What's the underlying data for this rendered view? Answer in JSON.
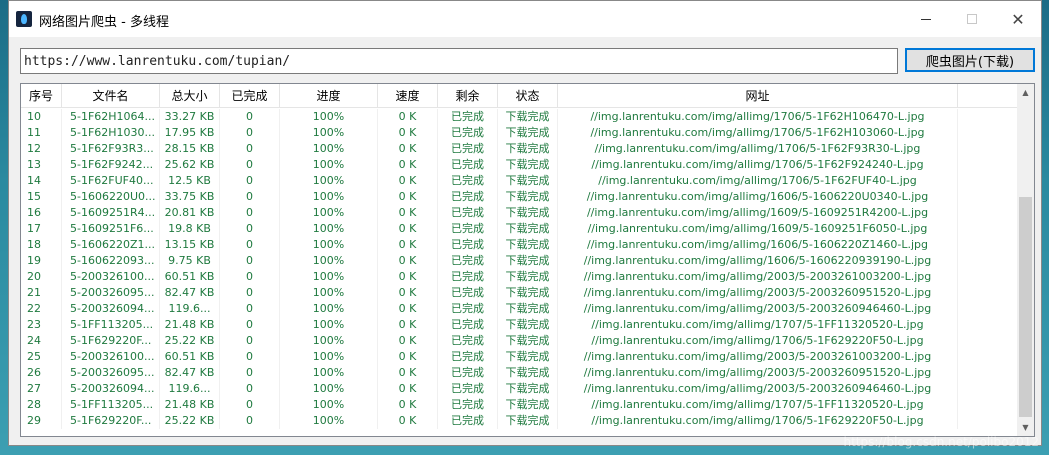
{
  "window": {
    "title": "网络图片爬虫 - 多线程",
    "close_glyph": "✕",
    "app_icon": "app-flame-icon"
  },
  "toolbar": {
    "url_value": "https://www.lanrentuku.com/tupian/",
    "crawl_button_label": "爬虫图片(下载)"
  },
  "table": {
    "columns": [
      "序号",
      "文件名",
      "总大小",
      "已完成",
      "进度",
      "速度",
      "剩余",
      "状态",
      "网址"
    ],
    "rows": [
      [
        "10",
        "5-1F62H1064...",
        "33.27 KB",
        "0",
        "100%",
        "0 K",
        "已完成",
        "下载完成",
        "//img.lanrentuku.com/img/allimg/1706/5-1F62H106470-L.jpg"
      ],
      [
        "11",
        "5-1F62H1030...",
        "17.95 KB",
        "0",
        "100%",
        "0 K",
        "已完成",
        "下载完成",
        "//img.lanrentuku.com/img/allimg/1706/5-1F62H103060-L.jpg"
      ],
      [
        "12",
        "5-1F62F93R3...",
        "28.15 KB",
        "0",
        "100%",
        "0 K",
        "已完成",
        "下载完成",
        "//img.lanrentuku.com/img/allimg/1706/5-1F62F93R30-L.jpg"
      ],
      [
        "13",
        "5-1F62F9242...",
        "25.62 KB",
        "0",
        "100%",
        "0 K",
        "已完成",
        "下载完成",
        "//img.lanrentuku.com/img/allimg/1706/5-1F62F924240-L.jpg"
      ],
      [
        "14",
        "5-1F62FUF40...",
        "12.5 KB",
        "0",
        "100%",
        "0 K",
        "已完成",
        "下载完成",
        "//img.lanrentuku.com/img/allimg/1706/5-1F62FUF40-L.jpg"
      ],
      [
        "15",
        "5-1606220U0...",
        "33.75 KB",
        "0",
        "100%",
        "0 K",
        "已完成",
        "下载完成",
        "//img.lanrentuku.com/img/allimg/1606/5-1606220U0340-L.jpg"
      ],
      [
        "16",
        "5-1609251R4...",
        "20.81 KB",
        "0",
        "100%",
        "0 K",
        "已完成",
        "下载完成",
        "//img.lanrentuku.com/img/allimg/1609/5-1609251R4200-L.jpg"
      ],
      [
        "17",
        "5-1609251F6...",
        "19.8 KB",
        "0",
        "100%",
        "0 K",
        "已完成",
        "下载完成",
        "//img.lanrentuku.com/img/allimg/1609/5-1609251F6050-L.jpg"
      ],
      [
        "18",
        "5-1606220Z1...",
        "13.15 KB",
        "0",
        "100%",
        "0 K",
        "已完成",
        "下载完成",
        "//img.lanrentuku.com/img/allimg/1606/5-1606220Z1460-L.jpg"
      ],
      [
        "19",
        "5-160622093...",
        "9.75 KB",
        "0",
        "100%",
        "0 K",
        "已完成",
        "下载完成",
        "//img.lanrentuku.com/img/allimg/1606/5-1606220939190-L.jpg"
      ],
      [
        "20",
        "5-200326100...",
        "60.51 KB",
        "0",
        "100%",
        "0 K",
        "已完成",
        "下载完成",
        "//img.lanrentuku.com/img/allimg/2003/5-2003261003200-L.jpg"
      ],
      [
        "21",
        "5-200326095...",
        "82.47 KB",
        "0",
        "100%",
        "0 K",
        "已完成",
        "下载完成",
        "//img.lanrentuku.com/img/allimg/2003/5-2003260951520-L.jpg"
      ],
      [
        "22",
        "5-200326094...",
        "119.6...",
        "0",
        "100%",
        "0 K",
        "已完成",
        "下载完成",
        "//img.lanrentuku.com/img/allimg/2003/5-2003260946460-L.jpg"
      ],
      [
        "23",
        "5-1FF113205...",
        "21.48 KB",
        "0",
        "100%",
        "0 K",
        "已完成",
        "下载完成",
        "//img.lanrentuku.com/img/allimg/1707/5-1FF11320520-L.jpg"
      ],
      [
        "24",
        "5-1F629220F...",
        "25.22 KB",
        "0",
        "100%",
        "0 K",
        "已完成",
        "下载完成",
        "//img.lanrentuku.com/img/allimg/1706/5-1F629220F50-L.jpg"
      ],
      [
        "25",
        "5-200326100...",
        "60.51 KB",
        "0",
        "100%",
        "0 K",
        "已完成",
        "下载完成",
        "//img.lanrentuku.com/img/allimg/2003/5-2003261003200-L.jpg"
      ],
      [
        "26",
        "5-200326095...",
        "82.47 KB",
        "0",
        "100%",
        "0 K",
        "已完成",
        "下载完成",
        "//img.lanrentuku.com/img/allimg/2003/5-2003260951520-L.jpg"
      ],
      [
        "27",
        "5-200326094...",
        "119.6...",
        "0",
        "100%",
        "0 K",
        "已完成",
        "下载完成",
        "//img.lanrentuku.com/img/allimg/2003/5-2003260946460-L.jpg"
      ],
      [
        "28",
        "5-1FF113205...",
        "21.48 KB",
        "0",
        "100%",
        "0 K",
        "已完成",
        "下载完成",
        "//img.lanrentuku.com/img/allimg/1707/5-1FF11320520-L.jpg"
      ],
      [
        "29",
        "5-1F629220F...",
        "25.22 KB",
        "0",
        "100%",
        "0 K",
        "已完成",
        "下载完成",
        "//img.lanrentuku.com/img/allimg/1706/5-1F629220F50-L.jpg"
      ]
    ]
  },
  "watermark": "https://blog.csdn.net/polibo2012",
  "colors": {
    "row_text": "#1f7a3f",
    "accent": "#0078d7"
  }
}
